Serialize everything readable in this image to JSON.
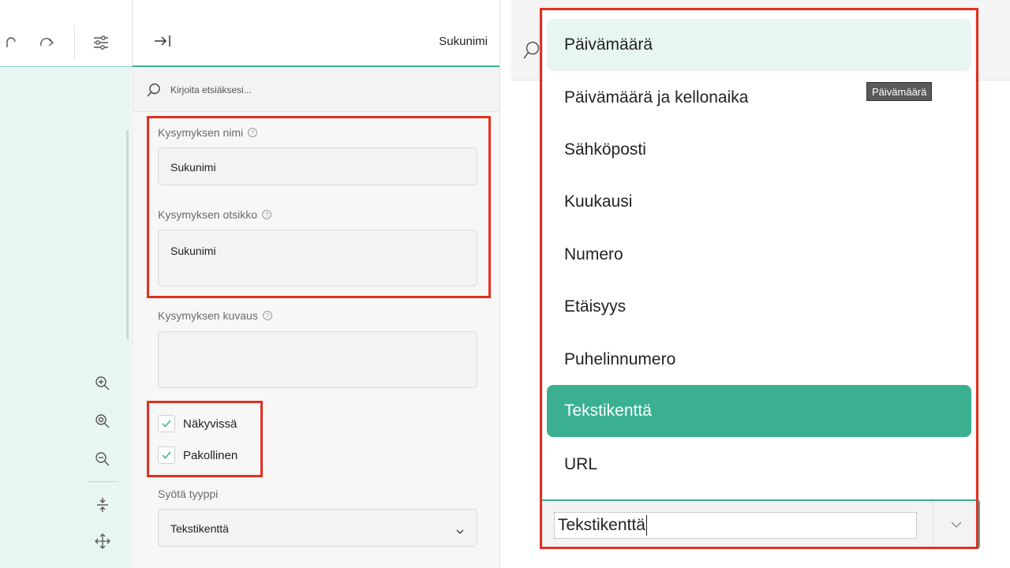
{
  "panel": {
    "title": "Sukunimi",
    "search_placeholder": "Kirjoita etsiäksesi...",
    "fields": {
      "name_label": "Kysymyksen nimi",
      "name_value": "Sukunimi",
      "title_label": "Kysymyksen otsikko",
      "title_value": "Sukunimi",
      "description_label": "Kysymyksen kuvaus",
      "description_value": ""
    },
    "checkboxes": {
      "visible_label": "Näkyvissä",
      "visible_checked": true,
      "required_label": "Pakollinen",
      "required_checked": true
    },
    "input_type_label": "Syötä tyyppi",
    "input_type_value": "Tekstikenttä"
  },
  "toolbar": {
    "icons": [
      "undo-icon",
      "redo-icon",
      "settings-sliders-icon"
    ],
    "zoom_icons": [
      "zoom-in-icon",
      "zoom-to-fit-icon",
      "zoom-out-icon",
      "collapse-icon",
      "move-icon"
    ]
  },
  "dropdown": {
    "options": [
      "Päivämäärä",
      "Päivämäärä ja kellonaika",
      "Sähköposti",
      "Kuukausi",
      "Numero",
      "Etäisyys",
      "Puhelinnumero",
      "Tekstikenttä",
      "URL"
    ],
    "selected": "Tekstikenttä",
    "tooltip": "Päivämäärä",
    "combo_value": "Tekstikenttä"
  },
  "colors": {
    "accent": "#3ab091",
    "highlight_light": "#e8f6f3",
    "annotation_red": "#e0301e"
  }
}
